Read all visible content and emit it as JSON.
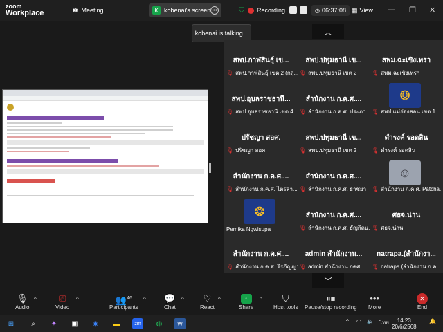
{
  "app": {
    "logo_line1": "zoom",
    "logo_line2": "Workplace"
  },
  "titlebar": {
    "meeting_label": "Meeting",
    "share_tab_label": "kobenai's screen",
    "recording_label": "Recording...",
    "timer": "06:37:08",
    "view_label": "View"
  },
  "toast": {
    "text": "kobenai is talking..."
  },
  "tiles": [
    {
      "name": "สพป.กาฬสินธุ์ เข...",
      "label": "สพป.กาฬสินธุ์ เขต 2 (กลุ...",
      "muted": true
    },
    {
      "name": "สพป.ปทุมธานี เข...",
      "label": "สพป.ปทุมธานี เขต 2",
      "muted": true
    },
    {
      "name": "สพม.ฉะเชิงเทรา",
      "label": "สพม.ฉะเชิงเทรา",
      "muted": true
    },
    {
      "name": "สพป.อุบลราชธานี...",
      "label": "สพป.อุบลราชธานี เขต 4",
      "muted": true
    },
    {
      "name": "สำนักงาน ก.ค.ศ....",
      "label": "สำนักงาน ก.ค.ศ. ประภา...",
      "muted": true
    },
    {
      "name": "",
      "label": "สพป.แม่ฮ่องสอน เขต 1",
      "muted": true,
      "picture": "emblem"
    },
    {
      "name": "ปรัชญา สอศ.",
      "label": "ปรัชญา สอศ.",
      "muted": true
    },
    {
      "name": "สพป.ปทุมธานี เข...",
      "label": "สพป.ปทุมธานี เขต 2",
      "muted": true
    },
    {
      "name": "ดำรงค์ รอดสิน",
      "label": "ดำรงค์ รอดสิน",
      "muted": true
    },
    {
      "name": "สำนักงาน ก.ค.ศ....",
      "label": "สำนักงาน ก.ค.ศ. ไตรลา...",
      "muted": true
    },
    {
      "name": "สำนักงาน ก.ค.ศ....",
      "label": "สำนักงาน ก.ค.ศ. ธาชยา",
      "muted": true
    },
    {
      "name": "",
      "label": "สำนักงาน ก.ค.ศ. Patcha...",
      "muted": true,
      "picture": "person"
    },
    {
      "name": "",
      "label": "Pemika Ngwisupa",
      "muted": false,
      "picture": "emblem"
    },
    {
      "name": "สำนักงาน ก.ค.ศ....",
      "label": "สำนักงาน ก.ค.ศ. ธัญกิตษ...",
      "muted": true
    },
    {
      "name": "ศธจ.น่าน",
      "label": "ศธจ.น่าน",
      "muted": true
    },
    {
      "name": "สำนักงาน ก.ค.ศ....",
      "label": "สำนักงาน ก.ค.ศ. จิรภิญญา",
      "muted": true
    },
    {
      "name": "admin สำนักงาน...",
      "label": "admin สำนักงาน กคศ",
      "muted": true
    },
    {
      "name": "natrapa.(สำนักงา...",
      "label": "natrapa.(สำนักงาน ก.ค...",
      "muted": true
    }
  ],
  "toolbar": {
    "audio": "Audio",
    "video": "Video",
    "participants": "Participants",
    "participants_count": "46",
    "chat": "Chat",
    "react": "React",
    "share": "Share",
    "host_tools": "Host tools",
    "record": "Pause/stop recording",
    "more": "More",
    "end": "End"
  },
  "taskbar": {
    "tray_lang": "ไทย",
    "time": "14:23",
    "date": "20/6/2568"
  },
  "colors": {
    "accent_green": "#16a34a",
    "end_red": "#c92a2a",
    "muted_red": "#e03131"
  }
}
